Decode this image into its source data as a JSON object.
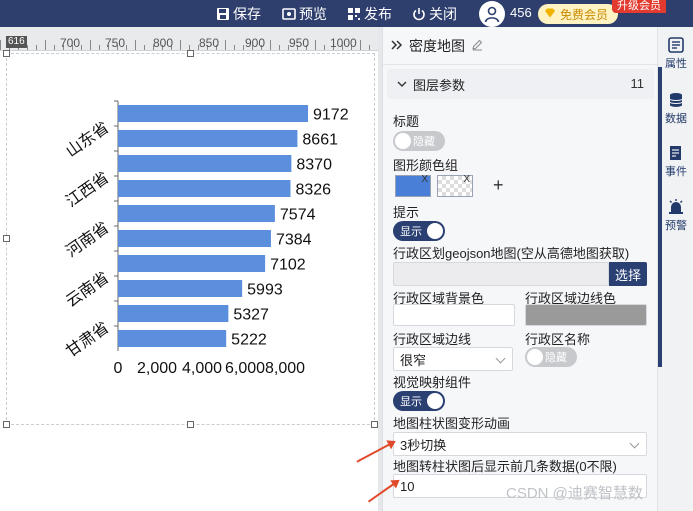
{
  "toolbar": {
    "save": "保存",
    "preview": "预览",
    "publish": "发布",
    "close": "关闭",
    "user_id": "456",
    "member_badge": "免费会员",
    "upgrade": "升级会员"
  },
  "ruler": {
    "marker": "616",
    "labels": [
      "700",
      "750",
      "800",
      "850",
      "900",
      "950",
      "1000"
    ]
  },
  "chart_data": {
    "type": "bar",
    "orientation": "horizontal",
    "categories": [
      "甘肃省",
      "",
      "云南省",
      "",
      "河南省",
      "",
      "江西省",
      "",
      "山东省",
      ""
    ],
    "values": [
      5222,
      5327,
      5993,
      7102,
      7384,
      7574,
      8326,
      8370,
      8661,
      9172
    ],
    "data_labels": [
      "5222",
      "5327",
      "5993",
      "7102",
      "7384",
      "7574",
      "8326",
      "8370",
      "8661",
      "9172"
    ],
    "x_ticks": [
      "0",
      "2,000",
      "4,000",
      "6,000",
      "8,000"
    ],
    "xlim": [
      0,
      10000
    ],
    "bar_color": "#5b8fdd",
    "grid": false,
    "legend": "none"
  },
  "panel": {
    "title": "密度地图",
    "group_title": "图层参数",
    "group_count": "11",
    "fields": {
      "title_label": "标题",
      "title_toggle": "隐藏",
      "color_group_label": "图形颜色组",
      "color_swatch_x": "X",
      "color_add": "+",
      "tip_label": "提示",
      "tip_toggle": "显示",
      "geojson_label": "行政区划geojson地图(空从高德地图获取)",
      "geojson_value": "",
      "geojson_select": "选择",
      "region_bg_label": "行政区域背景色",
      "region_border_color_label": "行政区域边线色",
      "region_border_label": "行政区域边线",
      "region_border_value": "很窄",
      "region_name_label": "行政区名称",
      "region_name_toggle": "隐藏",
      "visual_map_label": "视觉映射组件",
      "visual_map_toggle": "显示",
      "anim_label": "地图柱状图变形动画",
      "anim_value": "3秒切换",
      "topn_label": "地图转柱状图后显示前几条数据(0不限)",
      "topn_value": "10"
    },
    "colors": {
      "swatch_primary": "#4a7fd8",
      "region_border_color": "#9a9a9a"
    }
  },
  "rail": [
    {
      "icon": "attributes-icon",
      "label": "属性"
    },
    {
      "icon": "database-icon",
      "label": "数据"
    },
    {
      "icon": "event-icon",
      "label": "事件"
    },
    {
      "icon": "alarm-icon",
      "label": "预警"
    }
  ],
  "watermark": "CSDN @迪赛智慧数"
}
